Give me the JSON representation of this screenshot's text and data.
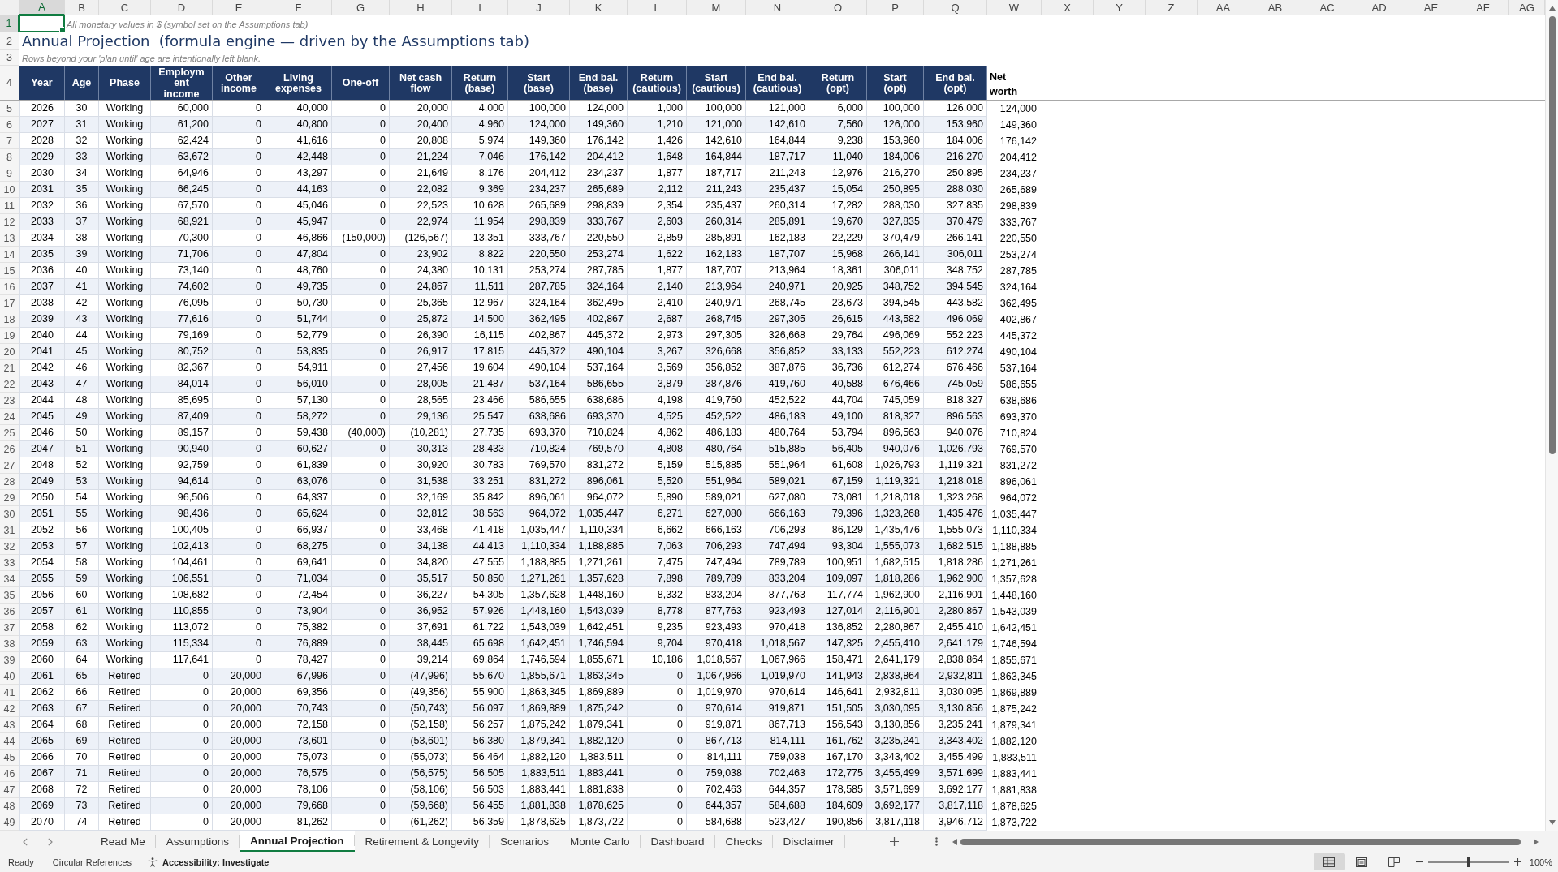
{
  "sheet": {
    "column_headers": [
      {
        "label": "A",
        "selected": true
      },
      {
        "label": "B",
        "selected": false
      },
      {
        "label": "C",
        "selected": false
      },
      {
        "label": "D",
        "selected": false
      },
      {
        "label": "E",
        "selected": false
      },
      {
        "label": "F",
        "selected": false
      },
      {
        "label": "G",
        "selected": false
      },
      {
        "label": "H",
        "selected": false
      },
      {
        "label": "I",
        "selected": false
      },
      {
        "label": "J",
        "selected": false
      },
      {
        "label": "K",
        "selected": false
      },
      {
        "label": "L",
        "selected": false
      },
      {
        "label": "M",
        "selected": false
      },
      {
        "label": "N",
        "selected": false
      },
      {
        "label": "O",
        "selected": false
      },
      {
        "label": "P",
        "selected": false
      },
      {
        "label": "Q",
        "selected": false
      },
      {
        "label": "W",
        "selected": false
      },
      {
        "label": "X",
        "selected": false
      },
      {
        "label": "Y",
        "selected": false
      },
      {
        "label": "Z",
        "selected": false
      },
      {
        "label": "AA",
        "selected": false
      },
      {
        "label": "AB",
        "selected": false
      },
      {
        "label": "AC",
        "selected": false
      },
      {
        "label": "AD",
        "selected": false
      },
      {
        "label": "AE",
        "selected": false
      },
      {
        "label": "AF",
        "selected": false
      },
      {
        "label": "AG",
        "selected": false
      }
    ],
    "row_headers": [
      {
        "label": "1",
        "selected": true
      },
      {
        "label": "2",
        "selected": false
      },
      {
        "label": "3",
        "selected": false
      },
      {
        "label": "4",
        "selected": false
      },
      {
        "label": "5",
        "selected": false
      },
      {
        "label": "6",
        "selected": false
      },
      {
        "label": "7",
        "selected": false
      },
      {
        "label": "8",
        "selected": false
      },
      {
        "label": "9",
        "selected": false
      },
      {
        "label": "10",
        "selected": false
      },
      {
        "label": "11",
        "selected": false
      },
      {
        "label": "12",
        "selected": false
      },
      {
        "label": "13",
        "selected": false
      },
      {
        "label": "14",
        "selected": false
      },
      {
        "label": "15",
        "selected": false
      },
      {
        "label": "16",
        "selected": false
      },
      {
        "label": "17",
        "selected": false
      },
      {
        "label": "18",
        "selected": false
      },
      {
        "label": "19",
        "selected": false
      },
      {
        "label": "20",
        "selected": false
      },
      {
        "label": "21",
        "selected": false
      },
      {
        "label": "22",
        "selected": false
      },
      {
        "label": "23",
        "selected": false
      },
      {
        "label": "24",
        "selected": false
      },
      {
        "label": "25",
        "selected": false
      },
      {
        "label": "26",
        "selected": false
      },
      {
        "label": "27",
        "selected": false
      },
      {
        "label": "28",
        "selected": false
      },
      {
        "label": "29",
        "selected": false
      },
      {
        "label": "30",
        "selected": false
      },
      {
        "label": "31",
        "selected": false
      },
      {
        "label": "32",
        "selected": false
      },
      {
        "label": "33",
        "selected": false
      },
      {
        "label": "34",
        "selected": false
      },
      {
        "label": "35",
        "selected": false
      },
      {
        "label": "36",
        "selected": false
      },
      {
        "label": "37",
        "selected": false
      },
      {
        "label": "38",
        "selected": false
      },
      {
        "label": "39",
        "selected": false
      },
      {
        "label": "40",
        "selected": false
      },
      {
        "label": "41",
        "selected": false
      },
      {
        "label": "42",
        "selected": false
      },
      {
        "label": "43",
        "selected": false
      },
      {
        "label": "44",
        "selected": false
      },
      {
        "label": "45",
        "selected": false
      },
      {
        "label": "46",
        "selected": false
      },
      {
        "label": "47",
        "selected": false
      },
      {
        "label": "48",
        "selected": false
      },
      {
        "label": "49",
        "selected": false
      }
    ],
    "note": "All monetary values in $ (symbol set on the Assumptions tab)",
    "title": "Annual Projection  (formula engine — driven by the Assumptions tab)",
    "subtitle": "Rows beyond your 'plan until' age are intentionally left blank.",
    "table": {
      "columns": [
        {
          "label": "Year",
          "kind": "key"
        },
        {
          "label": "Age",
          "kind": "key"
        },
        {
          "label": "Phase",
          "kind": "key"
        },
        {
          "label": "Employment income",
          "kind": "amount"
        },
        {
          "label": "Other income",
          "kind": "amount"
        },
        {
          "label": "Living expenses",
          "kind": "amount"
        },
        {
          "label": "One-off",
          "kind": "amount"
        },
        {
          "label": "Net cash flow",
          "kind": "amount"
        },
        {
          "label": "Return (base)",
          "kind": "amount"
        },
        {
          "label": "Start (base)",
          "kind": "amount"
        },
        {
          "label": "End bal. (base)",
          "kind": "amount"
        },
        {
          "label": "Return (cautious)",
          "kind": "amount"
        },
        {
          "label": "Start (cautious)",
          "kind": "amount"
        },
        {
          "label": "End bal. (cautious)",
          "kind": "amount"
        },
        {
          "label": "Return (opt)",
          "kind": "amount"
        },
        {
          "label": "Start (opt)",
          "kind": "amount"
        },
        {
          "label": "End bal. (opt)",
          "kind": "amount"
        },
        {
          "label": "Net worth",
          "kind": "summary"
        }
      ],
      "rows": [
        [
          "2026",
          "30",
          "Working",
          "60,000",
          "0",
          "40,000",
          "0",
          "20,000",
          "4,000",
          "100,000",
          "124,000",
          "1,000",
          "100,000",
          "121,000",
          "6,000",
          "100,000",
          "126,000",
          "124,000"
        ],
        [
          "2027",
          "31",
          "Working",
          "61,200",
          "0",
          "40,800",
          "0",
          "20,400",
          "4,960",
          "124,000",
          "149,360",
          "1,210",
          "121,000",
          "142,610",
          "7,560",
          "126,000",
          "153,960",
          "149,360"
        ],
        [
          "2028",
          "32",
          "Working",
          "62,424",
          "0",
          "41,616",
          "0",
          "20,808",
          "5,974",
          "149,360",
          "176,142",
          "1,426",
          "142,610",
          "164,844",
          "9,238",
          "153,960",
          "184,006",
          "176,142"
        ],
        [
          "2029",
          "33",
          "Working",
          "63,672",
          "0",
          "42,448",
          "0",
          "21,224",
          "7,046",
          "176,142",
          "204,412",
          "1,648",
          "164,844",
          "187,717",
          "11,040",
          "184,006",
          "216,270",
          "204,412"
        ],
        [
          "2030",
          "34",
          "Working",
          "64,946",
          "0",
          "43,297",
          "0",
          "21,649",
          "8,176",
          "204,412",
          "234,237",
          "1,877",
          "187,717",
          "211,243",
          "12,976",
          "216,270",
          "250,895",
          "234,237"
        ],
        [
          "2031",
          "35",
          "Working",
          "66,245",
          "0",
          "44,163",
          "0",
          "22,082",
          "9,369",
          "234,237",
          "265,689",
          "2,112",
          "211,243",
          "235,437",
          "15,054",
          "250,895",
          "288,030",
          "265,689"
        ],
        [
          "2032",
          "36",
          "Working",
          "67,570",
          "0",
          "45,046",
          "0",
          "22,523",
          "10,628",
          "265,689",
          "298,839",
          "2,354",
          "235,437",
          "260,314",
          "17,282",
          "288,030",
          "327,835",
          "298,839"
        ],
        [
          "2033",
          "37",
          "Working",
          "68,921",
          "0",
          "45,947",
          "0",
          "22,974",
          "11,954",
          "298,839",
          "333,767",
          "2,603",
          "260,314",
          "285,891",
          "19,670",
          "327,835",
          "370,479",
          "333,767"
        ],
        [
          "2034",
          "38",
          "Working",
          "70,300",
          "0",
          "46,866",
          "(150,000)",
          "(126,567)",
          "13,351",
          "333,767",
          "220,550",
          "2,859",
          "285,891",
          "162,183",
          "22,229",
          "370,479",
          "266,141",
          "220,550"
        ],
        [
          "2035",
          "39",
          "Working",
          "71,706",
          "0",
          "47,804",
          "0",
          "23,902",
          "8,822",
          "220,550",
          "253,274",
          "1,622",
          "162,183",
          "187,707",
          "15,968",
          "266,141",
          "306,011",
          "253,274"
        ],
        [
          "2036",
          "40",
          "Working",
          "73,140",
          "0",
          "48,760",
          "0",
          "24,380",
          "10,131",
          "253,274",
          "287,785",
          "1,877",
          "187,707",
          "213,964",
          "18,361",
          "306,011",
          "348,752",
          "287,785"
        ],
        [
          "2037",
          "41",
          "Working",
          "74,602",
          "0",
          "49,735",
          "0",
          "24,867",
          "11,511",
          "287,785",
          "324,164",
          "2,140",
          "213,964",
          "240,971",
          "20,925",
          "348,752",
          "394,545",
          "324,164"
        ],
        [
          "2038",
          "42",
          "Working",
          "76,095",
          "0",
          "50,730",
          "0",
          "25,365",
          "12,967",
          "324,164",
          "362,495",
          "2,410",
          "240,971",
          "268,745",
          "23,673",
          "394,545",
          "443,582",
          "362,495"
        ],
        [
          "2039",
          "43",
          "Working",
          "77,616",
          "0",
          "51,744",
          "0",
          "25,872",
          "14,500",
          "362,495",
          "402,867",
          "2,687",
          "268,745",
          "297,305",
          "26,615",
          "443,582",
          "496,069",
          "402,867"
        ],
        [
          "2040",
          "44",
          "Working",
          "79,169",
          "0",
          "52,779",
          "0",
          "26,390",
          "16,115",
          "402,867",
          "445,372",
          "2,973",
          "297,305",
          "326,668",
          "29,764",
          "496,069",
          "552,223",
          "445,372"
        ],
        [
          "2041",
          "45",
          "Working",
          "80,752",
          "0",
          "53,835",
          "0",
          "26,917",
          "17,815",
          "445,372",
          "490,104",
          "3,267",
          "326,668",
          "356,852",
          "33,133",
          "552,223",
          "612,274",
          "490,104"
        ],
        [
          "2042",
          "46",
          "Working",
          "82,367",
          "0",
          "54,911",
          "0",
          "27,456",
          "19,604",
          "490,104",
          "537,164",
          "3,569",
          "356,852",
          "387,876",
          "36,736",
          "612,274",
          "676,466",
          "537,164"
        ],
        [
          "2043",
          "47",
          "Working",
          "84,014",
          "0",
          "56,010",
          "0",
          "28,005",
          "21,487",
          "537,164",
          "586,655",
          "3,879",
          "387,876",
          "419,760",
          "40,588",
          "676,466",
          "745,059",
          "586,655"
        ],
        [
          "2044",
          "48",
          "Working",
          "85,695",
          "0",
          "57,130",
          "0",
          "28,565",
          "23,466",
          "586,655",
          "638,686",
          "4,198",
          "419,760",
          "452,522",
          "44,704",
          "745,059",
          "818,327",
          "638,686"
        ],
        [
          "2045",
          "49",
          "Working",
          "87,409",
          "0",
          "58,272",
          "0",
          "29,136",
          "25,547",
          "638,686",
          "693,370",
          "4,525",
          "452,522",
          "486,183",
          "49,100",
          "818,327",
          "896,563",
          "693,370"
        ],
        [
          "2046",
          "50",
          "Working",
          "89,157",
          "0",
          "59,438",
          "(40,000)",
          "(10,281)",
          "27,735",
          "693,370",
          "710,824",
          "4,862",
          "486,183",
          "480,764",
          "53,794",
          "896,563",
          "940,076",
          "710,824"
        ],
        [
          "2047",
          "51",
          "Working",
          "90,940",
          "0",
          "60,627",
          "0",
          "30,313",
          "28,433",
          "710,824",
          "769,570",
          "4,808",
          "480,764",
          "515,885",
          "56,405",
          "940,076",
          "1,026,793",
          "769,570"
        ],
        [
          "2048",
          "52",
          "Working",
          "92,759",
          "0",
          "61,839",
          "0",
          "30,920",
          "30,783",
          "769,570",
          "831,272",
          "5,159",
          "515,885",
          "551,964",
          "61,608",
          "1,026,793",
          "1,119,321",
          "831,272"
        ],
        [
          "2049",
          "53",
          "Working",
          "94,614",
          "0",
          "63,076",
          "0",
          "31,538",
          "33,251",
          "831,272",
          "896,061",
          "5,520",
          "551,964",
          "589,021",
          "67,159",
          "1,119,321",
          "1,218,018",
          "896,061"
        ],
        [
          "2050",
          "54",
          "Working",
          "96,506",
          "0",
          "64,337",
          "0",
          "32,169",
          "35,842",
          "896,061",
          "964,072",
          "5,890",
          "589,021",
          "627,080",
          "73,081",
          "1,218,018",
          "1,323,268",
          "964,072"
        ],
        [
          "2051",
          "55",
          "Working",
          "98,436",
          "0",
          "65,624",
          "0",
          "32,812",
          "38,563",
          "964,072",
          "1,035,447",
          "6,271",
          "627,080",
          "666,163",
          "79,396",
          "1,323,268",
          "1,435,476",
          "1,035,447"
        ],
        [
          "2052",
          "56",
          "Working",
          "100,405",
          "0",
          "66,937",
          "0",
          "33,468",
          "41,418",
          "1,035,447",
          "1,110,334",
          "6,662",
          "666,163",
          "706,293",
          "86,129",
          "1,435,476",
          "1,555,073",
          "1,110,334"
        ],
        [
          "2053",
          "57",
          "Working",
          "102,413",
          "0",
          "68,275",
          "0",
          "34,138",
          "44,413",
          "1,110,334",
          "1,188,885",
          "7,063",
          "706,293",
          "747,494",
          "93,304",
          "1,555,073",
          "1,682,515",
          "1,188,885"
        ],
        [
          "2054",
          "58",
          "Working",
          "104,461",
          "0",
          "69,641",
          "0",
          "34,820",
          "47,555",
          "1,188,885",
          "1,271,261",
          "7,475",
          "747,494",
          "789,789",
          "100,951",
          "1,682,515",
          "1,818,286",
          "1,271,261"
        ],
        [
          "2055",
          "59",
          "Working",
          "106,551",
          "0",
          "71,034",
          "0",
          "35,517",
          "50,850",
          "1,271,261",
          "1,357,628",
          "7,898",
          "789,789",
          "833,204",
          "109,097",
          "1,818,286",
          "1,962,900",
          "1,357,628"
        ],
        [
          "2056",
          "60",
          "Working",
          "108,682",
          "0",
          "72,454",
          "0",
          "36,227",
          "54,305",
          "1,357,628",
          "1,448,160",
          "8,332",
          "833,204",
          "877,763",
          "117,774",
          "1,962,900",
          "2,116,901",
          "1,448,160"
        ],
        [
          "2057",
          "61",
          "Working",
          "110,855",
          "0",
          "73,904",
          "0",
          "36,952",
          "57,926",
          "1,448,160",
          "1,543,039",
          "8,778",
          "877,763",
          "923,493",
          "127,014",
          "2,116,901",
          "2,280,867",
          "1,543,039"
        ],
        [
          "2058",
          "62",
          "Working",
          "113,072",
          "0",
          "75,382",
          "0",
          "37,691",
          "61,722",
          "1,543,039",
          "1,642,451",
          "9,235",
          "923,493",
          "970,418",
          "136,852",
          "2,280,867",
          "2,455,410",
          "1,642,451"
        ],
        [
          "2059",
          "63",
          "Working",
          "115,334",
          "0",
          "76,889",
          "0",
          "38,445",
          "65,698",
          "1,642,451",
          "1,746,594",
          "9,704",
          "970,418",
          "1,018,567",
          "147,325",
          "2,455,410",
          "2,641,179",
          "1,746,594"
        ],
        [
          "2060",
          "64",
          "Working",
          "117,641",
          "0",
          "78,427",
          "0",
          "39,214",
          "69,864",
          "1,746,594",
          "1,855,671",
          "10,186",
          "1,018,567",
          "1,067,966",
          "158,471",
          "2,641,179",
          "2,838,864",
          "1,855,671"
        ],
        [
          "2061",
          "65",
          "Retired",
          "0",
          "20,000",
          "67,996",
          "0",
          "(47,996)",
          "55,670",
          "1,855,671",
          "1,863,345",
          "0",
          "1,067,966",
          "1,019,970",
          "141,943",
          "2,838,864",
          "2,932,811",
          "1,863,345"
        ],
        [
          "2062",
          "66",
          "Retired",
          "0",
          "20,000",
          "69,356",
          "0",
          "(49,356)",
          "55,900",
          "1,863,345",
          "1,869,889",
          "0",
          "1,019,970",
          "970,614",
          "146,641",
          "2,932,811",
          "3,030,095",
          "1,869,889"
        ],
        [
          "2063",
          "67",
          "Retired",
          "0",
          "20,000",
          "70,743",
          "0",
          "(50,743)",
          "56,097",
          "1,869,889",
          "1,875,242",
          "0",
          "970,614",
          "919,871",
          "151,505",
          "3,030,095",
          "3,130,856",
          "1,875,242"
        ],
        [
          "2064",
          "68",
          "Retired",
          "0",
          "20,000",
          "72,158",
          "0",
          "(52,158)",
          "56,257",
          "1,875,242",
          "1,879,341",
          "0",
          "919,871",
          "867,713",
          "156,543",
          "3,130,856",
          "3,235,241",
          "1,879,341"
        ],
        [
          "2065",
          "69",
          "Retired",
          "0",
          "20,000",
          "73,601",
          "0",
          "(53,601)",
          "56,380",
          "1,879,341",
          "1,882,120",
          "0",
          "867,713",
          "814,111",
          "161,762",
          "3,235,241",
          "3,343,402",
          "1,882,120"
        ],
        [
          "2066",
          "70",
          "Retired",
          "0",
          "20,000",
          "75,073",
          "0",
          "(55,073)",
          "56,464",
          "1,882,120",
          "1,883,511",
          "0",
          "814,111",
          "759,038",
          "167,170",
          "3,343,402",
          "3,455,499",
          "1,883,511"
        ],
        [
          "2067",
          "71",
          "Retired",
          "0",
          "20,000",
          "76,575",
          "0",
          "(56,575)",
          "56,505",
          "1,883,511",
          "1,883,441",
          "0",
          "759,038",
          "702,463",
          "172,775",
          "3,455,499",
          "3,571,699",
          "1,883,441"
        ],
        [
          "2068",
          "72",
          "Retired",
          "0",
          "20,000",
          "78,106",
          "0",
          "(58,106)",
          "56,503",
          "1,883,441",
          "1,881,838",
          "0",
          "702,463",
          "644,357",
          "178,585",
          "3,571,699",
          "3,692,177",
          "1,881,838"
        ],
        [
          "2069",
          "73",
          "Retired",
          "0",
          "20,000",
          "79,668",
          "0",
          "(59,668)",
          "56,455",
          "1,881,838",
          "1,878,625",
          "0",
          "644,357",
          "584,688",
          "184,609",
          "3,692,177",
          "3,817,118",
          "1,878,625"
        ],
        [
          "2070",
          "74",
          "Retired",
          "0",
          "20,000",
          "81,262",
          "0",
          "(61,262)",
          "56,359",
          "1,878,625",
          "1,873,722",
          "0",
          "584,688",
          "523,427",
          "190,856",
          "3,817,118",
          "3,946,712",
          "1,873,722"
        ]
      ]
    }
  },
  "sheet_tabs": [
    {
      "label": "Read Me",
      "selected": false
    },
    {
      "label": "Assumptions",
      "selected": false
    },
    {
      "label": "Annual Projection",
      "selected": true
    },
    {
      "label": "Retirement & Longevity",
      "selected": false
    },
    {
      "label": "Scenarios",
      "selected": false
    },
    {
      "label": "Monte Carlo",
      "selected": false
    },
    {
      "label": "Dashboard",
      "selected": false
    },
    {
      "label": "Checks",
      "selected": false
    },
    {
      "label": "Disclaimer",
      "selected": false
    }
  ],
  "status_bar": {
    "status": "Ready",
    "circular_references": "Circular References",
    "accessibility": "Accessibility: Investigate",
    "views": [
      {
        "kind": "normal",
        "selected": true
      },
      {
        "kind": "page_layout",
        "selected": false
      },
      {
        "kind": "page_break",
        "selected": false
      }
    ],
    "zoom": {
      "level": 0.5,
      "reading": "100%"
    }
  }
}
